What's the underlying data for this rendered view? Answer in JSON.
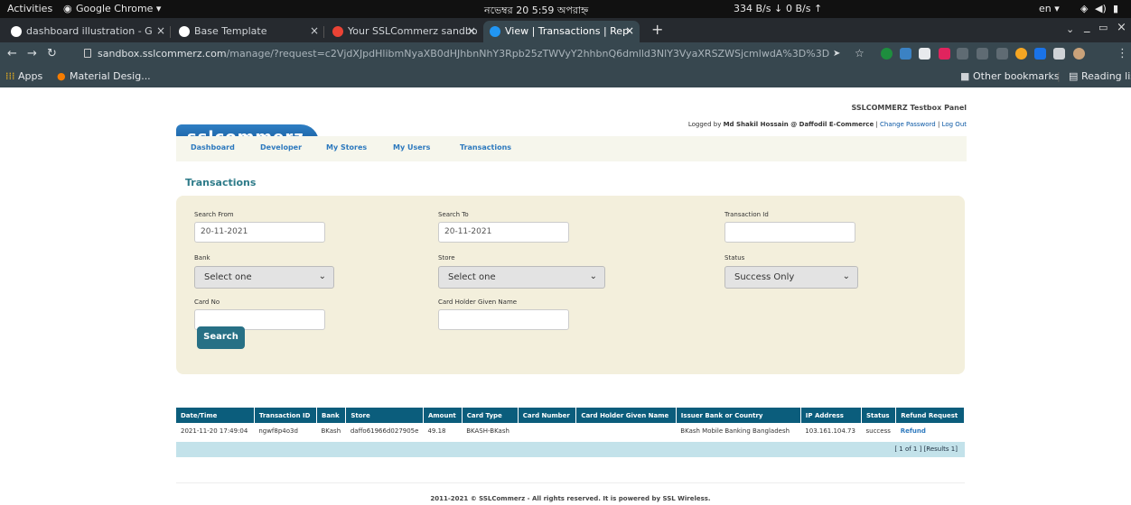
{
  "os_bar": {
    "activities": "Activities",
    "app": "Google Chrome ▾",
    "clock": "নভেম্বর 20  5:59 অপরাহ্ন",
    "net_down": "334 B/s ↓",
    "net_up": "0 B/s ↑",
    "lang": "en ▾"
  },
  "tabs": [
    {
      "title": "dashboard illustration - G",
      "color": "#ffffff"
    },
    {
      "title": "Base Template",
      "color": "#ffffff"
    },
    {
      "title": "Your SSLCommerz sandbo",
      "color": "#ea4335"
    },
    {
      "title": "View | Transactions | Rep",
      "color": "#2196f3"
    }
  ],
  "url": {
    "host": "sandbox.sslcommerz.com",
    "path": "/manage/?request=c2VjdXJpdHlibmNyaXB0dHJhbnNhY3Rpb25zTWVyY2hhbnQ6dmlld3NlY3VyaXRSZWSjcmlwdA%3D%3D"
  },
  "bookmarks": {
    "apps": "Apps",
    "material": "Material Desig...",
    "other": "Other bookmarks",
    "reading": "Reading list"
  },
  "brand": {
    "logo": "sslcommerz",
    "panel_title": "SSLCOMMERZ Testbox Panel",
    "logged_prefix": "Logged by ",
    "user": "Md Shakil Hossain @ Daffodil E-Commerce",
    "change_password": "Change Password",
    "logout": "Log Out",
    "sep": " | "
  },
  "topnav": [
    "Dashboard",
    "Developer",
    "My Stores",
    "My Users",
    "Transactions"
  ],
  "page_title": "Transactions",
  "filter": {
    "search_from_label": "Search From",
    "search_from_value": "20-11-2021",
    "search_to_label": "Search To",
    "search_to_value": "20-11-2021",
    "transaction_id_label": "Transaction Id",
    "bank_label": "Bank",
    "bank_value": "Select one",
    "store_label": "Store",
    "store_value": "Select one",
    "status_label": "Status",
    "status_value": "Success Only",
    "card_no_label": "Card No",
    "card_holder_label": "Card Holder Given Name",
    "search_button": "Search"
  },
  "table": {
    "headers": [
      "Date/Time",
      "Transaction ID",
      "Bank",
      "Store",
      "Amount",
      "Card Type",
      "Card Number",
      "Card Holder Given Name",
      "Issuer Bank or Country",
      "IP Address",
      "Status",
      "Refund Request"
    ],
    "rows": [
      [
        "2021-11-20 17:49:04",
        "ngwf8p4o3d",
        "BKash",
        "daffo61966d027905e",
        "49.18",
        "BKASH-BKash",
        "",
        "",
        "BKash Mobile Banking Bangladesh",
        "103.161.104.73",
        "success",
        "Refund"
      ]
    ],
    "pager": "[ 1  of  1 ] [Results 1]"
  },
  "footer": "2011-2021 © SSLCommerz - All rights reserved. It is powered by SSL Wireless."
}
